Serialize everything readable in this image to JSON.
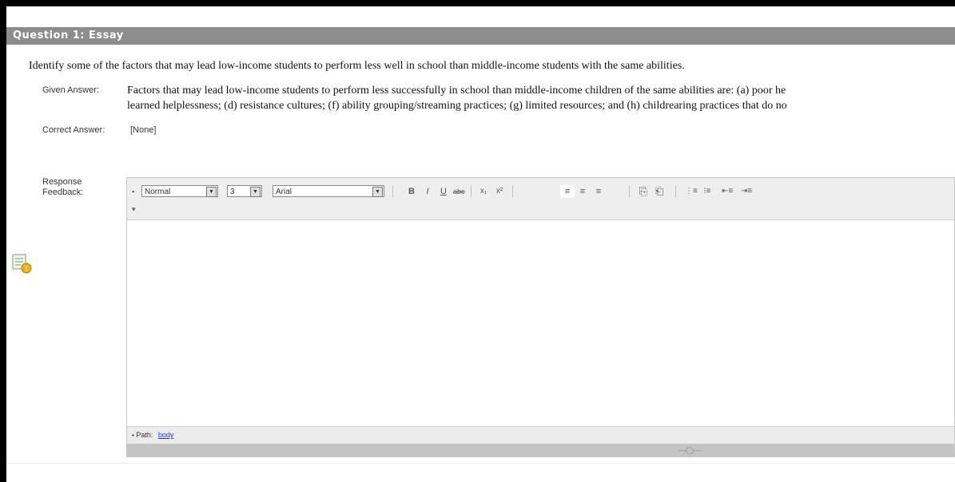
{
  "question": {
    "header": "Question 1:  Essay",
    "text": "Identify some of the factors that may lead low-income students to perform less well in school than middle-income students with the same abilities.",
    "given_label": "Given Answer:",
    "given_line1": "Factors that may lead low-income students to perform less successfully in school than middle-income children of the same abilities are: (a) poor he",
    "given_line2": "learned helplessness; (d) resistance cultures; (f) ability grouping/streaming practices; (g) limited resources; and (h) childrearing practices that do no",
    "correct_label": "Correct Answer:",
    "correct_value": "[None]",
    "feedback_label": "Response Feedback:"
  },
  "editor": {
    "style_select": "Normal",
    "size_select": "3",
    "font_select": "Arial",
    "buttons": {
      "bold": "B",
      "italic": "I",
      "underline": "U",
      "strike": "abc",
      "subscript": "x₁",
      "superscript": "x²",
      "align_left": "≡",
      "align_center": "≡",
      "align_right": "≡",
      "paste": "⎘",
      "paste_word": "⎗",
      "ordered_list": "⋮≡",
      "unordered_list": "⁝≡",
      "outdent": "⇤≡",
      "indent": "⇥≡"
    },
    "path_label": "Path:",
    "path_value": "body",
    "grip": "—◯—"
  }
}
